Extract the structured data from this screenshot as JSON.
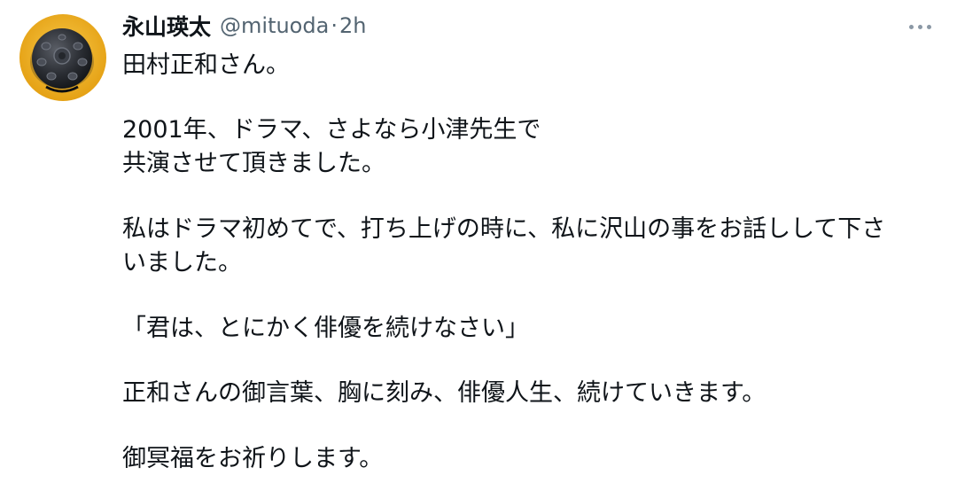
{
  "tweet": {
    "display_name": "永山瑛太",
    "handle": "@mituoda",
    "separator": "·",
    "time": "2h",
    "lines": [
      "田村正和さん。",
      "2001年、ドラマ、さよなら小津先生で",
      "共演させて頂きました。",
      "私はドラマ初めてで、打ち上げの時に、私に沢山の事をお話しして下さ",
      "いました。",
      "「君は、とにかく俳優を続けなさい」",
      "正和さんの御言葉、胸に刻み、俳優人生、続けていきます。",
      "御冥福をお祈りします。"
    ]
  },
  "icons": {
    "avatar": "handpan-drum-avatar",
    "more": "more-horizontal-icon"
  },
  "colors": {
    "text": "#0f1419",
    "secondary": "#536471",
    "avatar_bg": "#f2b21c"
  }
}
